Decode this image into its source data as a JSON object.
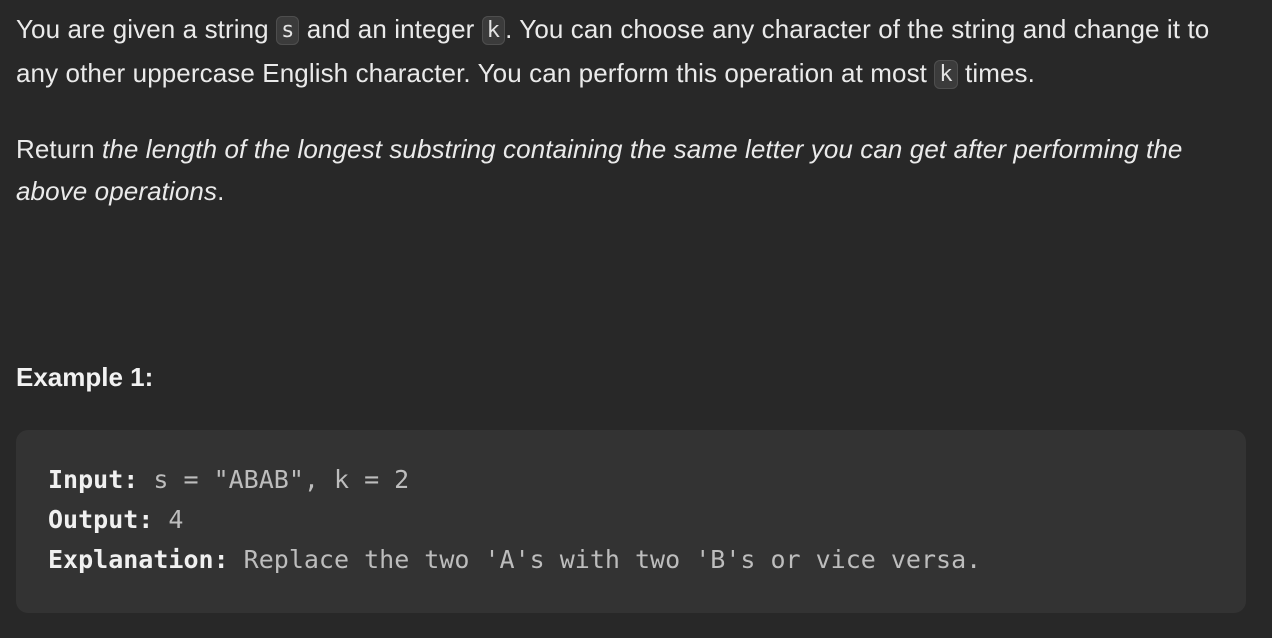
{
  "description": {
    "p1_t1": "You are given a string ",
    "s_code": "s",
    "p1_t2": " and an integer ",
    "k_code": "k",
    "p1_t3": ". You can choose any character of the string and change it to any other uppercase English character. You can perform this operation at most ",
    "k_code_2": "k",
    "p1_t4": " times.",
    "p2_t1": "Return ",
    "p2_em": "the length of the longest substring containing the same letter you can get after performing the above operations",
    "p2_t2": "."
  },
  "example": {
    "title": "Example 1:",
    "input_label": "Input:",
    "input_value": " s = \"ABAB\", k = 2",
    "output_label": "Output:",
    "output_value": " 4",
    "explanation_label": "Explanation:",
    "explanation_value": " Replace the two 'A's with two 'B's or vice versa."
  }
}
